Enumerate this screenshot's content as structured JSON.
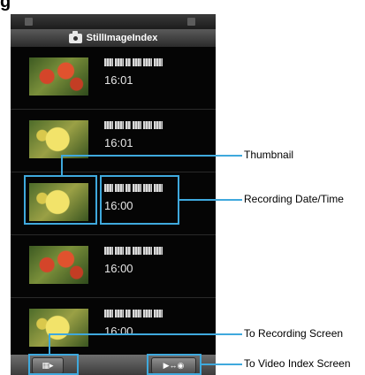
{
  "page_heading": "g",
  "app": {
    "title": "StillImageIndex",
    "title_icon": "camera-icon"
  },
  "items": [
    {
      "time": "16:01",
      "thumbnail": "red-flowers"
    },
    {
      "time": "16:01",
      "thumbnail": "yellow-flower"
    },
    {
      "time": "16:00",
      "thumbnail": "yellow-flower"
    },
    {
      "time": "16:00",
      "thumbnail": "red-flowers"
    },
    {
      "time": "16:00",
      "thumbnail": "yellow-flower"
    }
  ],
  "bottom_bar": {
    "record_button_icon": "recording-screen-icon",
    "video_index_button_icon": "video-camera-swap-icon"
  },
  "callouts": {
    "thumbnail": "Thumbnail",
    "recording_datetime": "Recording Date/Time",
    "to_recording": "To Recording Screen",
    "to_video_index": "To Video Index Screen"
  },
  "colors": {
    "highlight": "#3fa9dd",
    "screen_background": "#050505"
  }
}
